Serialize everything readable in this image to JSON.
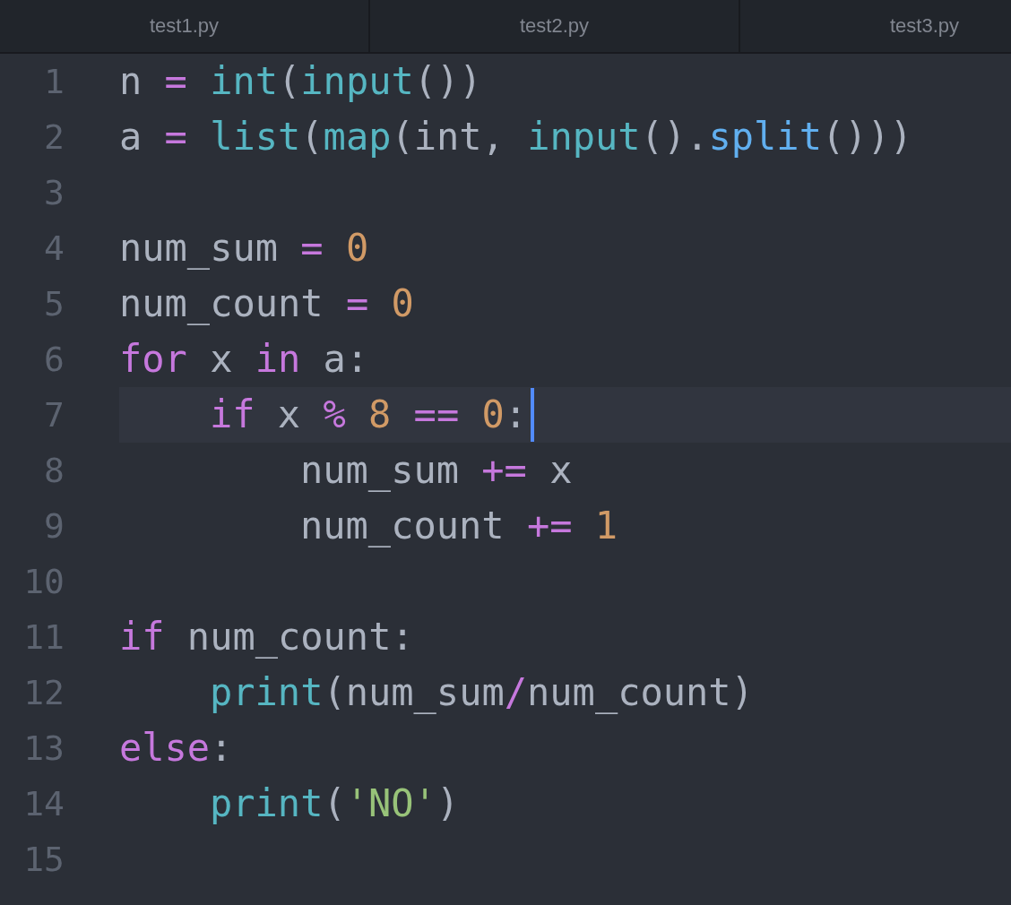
{
  "tabs": [
    {
      "label": "test1.py",
      "selected": false
    },
    {
      "label": "test2.py",
      "selected": false
    },
    {
      "label": "test3.py",
      "selected": false
    }
  ],
  "lines": [
    {
      "number": "1",
      "current": false,
      "tokens": [
        {
          "kind": "plain",
          "text": "n "
        },
        {
          "kind": "operator",
          "text": "= "
        },
        {
          "kind": "builtin",
          "text": "int"
        },
        {
          "kind": "plain",
          "text": "("
        },
        {
          "kind": "builtin",
          "text": "input"
        },
        {
          "kind": "plain",
          "text": "())"
        }
      ]
    },
    {
      "number": "2",
      "current": false,
      "tokens": [
        {
          "kind": "plain",
          "text": "a "
        },
        {
          "kind": "operator",
          "text": "= "
        },
        {
          "kind": "builtin",
          "text": "list"
        },
        {
          "kind": "plain",
          "text": "("
        },
        {
          "kind": "builtin",
          "text": "map"
        },
        {
          "kind": "plain",
          "text": "(int, "
        },
        {
          "kind": "builtin",
          "text": "input"
        },
        {
          "kind": "plain",
          "text": "()."
        },
        {
          "kind": "function",
          "text": "split"
        },
        {
          "kind": "plain",
          "text": "()))"
        }
      ]
    },
    {
      "number": "3",
      "current": false
    },
    {
      "number": "4",
      "current": false,
      "tokens": [
        {
          "kind": "plain",
          "text": "num_sum "
        },
        {
          "kind": "operator",
          "text": "= "
        },
        {
          "kind": "number",
          "text": "0"
        }
      ]
    },
    {
      "number": "5",
      "current": false,
      "tokens": [
        {
          "kind": "plain",
          "text": "num_count "
        },
        {
          "kind": "operator",
          "text": "= "
        },
        {
          "kind": "number",
          "text": "0"
        }
      ]
    },
    {
      "number": "6",
      "current": false,
      "tokens": [
        {
          "kind": "keyword",
          "text": "for "
        },
        {
          "kind": "plain",
          "text": "x "
        },
        {
          "kind": "keyword",
          "text": "in "
        },
        {
          "kind": "plain",
          "text": "a:"
        }
      ],
      "children": [
        {
          "number": "7",
          "current": true,
          "tokens": [
            {
              "kind": "keyword",
              "text": "if "
            },
            {
              "kind": "plain",
              "text": "x "
            },
            {
              "kind": "operator",
              "text": "% "
            },
            {
              "kind": "number",
              "text": "8 "
            },
            {
              "kind": "operator",
              "text": "== "
            },
            {
              "kind": "number",
              "text": "0"
            },
            {
              "kind": "plain",
              "text": ":"
            }
          ],
          "children": [
            {
              "number": "8",
              "current": false,
              "tokens": [
                {
                  "kind": "plain",
                  "text": "num_sum "
                },
                {
                  "kind": "operator",
                  "text": "+= "
                },
                {
                  "kind": "plain",
                  "text": "x"
                }
              ]
            },
            {
              "number": "9",
              "current": false,
              "tokens": [
                {
                  "kind": "plain",
                  "text": "num_count "
                },
                {
                  "kind": "operator",
                  "text": "+= "
                },
                {
                  "kind": "number",
                  "text": "1"
                }
              ]
            }
          ]
        }
      ]
    },
    {
      "number": "10",
      "current": false
    },
    {
      "number": "11",
      "current": false,
      "tokens": [
        {
          "kind": "keyword",
          "text": "if "
        },
        {
          "kind": "plain",
          "text": "num_count:"
        }
      ],
      "children": [
        {
          "number": "12",
          "current": false,
          "tokens": [
            {
              "kind": "builtin",
              "text": "print"
            },
            {
              "kind": "plain",
              "text": "(num_sum"
            },
            {
              "kind": "operator",
              "text": "/"
            },
            {
              "kind": "plain",
              "text": "num_count)"
            }
          ]
        }
      ]
    },
    {
      "number": "13",
      "current": false,
      "tokens": [
        {
          "kind": "keyword",
          "text": "else"
        },
        {
          "kind": "plain",
          "text": ":"
        }
      ],
      "children": [
        {
          "number": "14",
          "current": false,
          "tokens": [
            {
              "kind": "builtin",
              "text": "print"
            },
            {
              "kind": "plain",
              "text": "("
            },
            {
              "kind": "string",
              "text": "'NO'"
            },
            {
              "kind": "plain",
              "text": ")"
            }
          ]
        }
      ]
    },
    {
      "number": "15",
      "current": false
    }
  ]
}
